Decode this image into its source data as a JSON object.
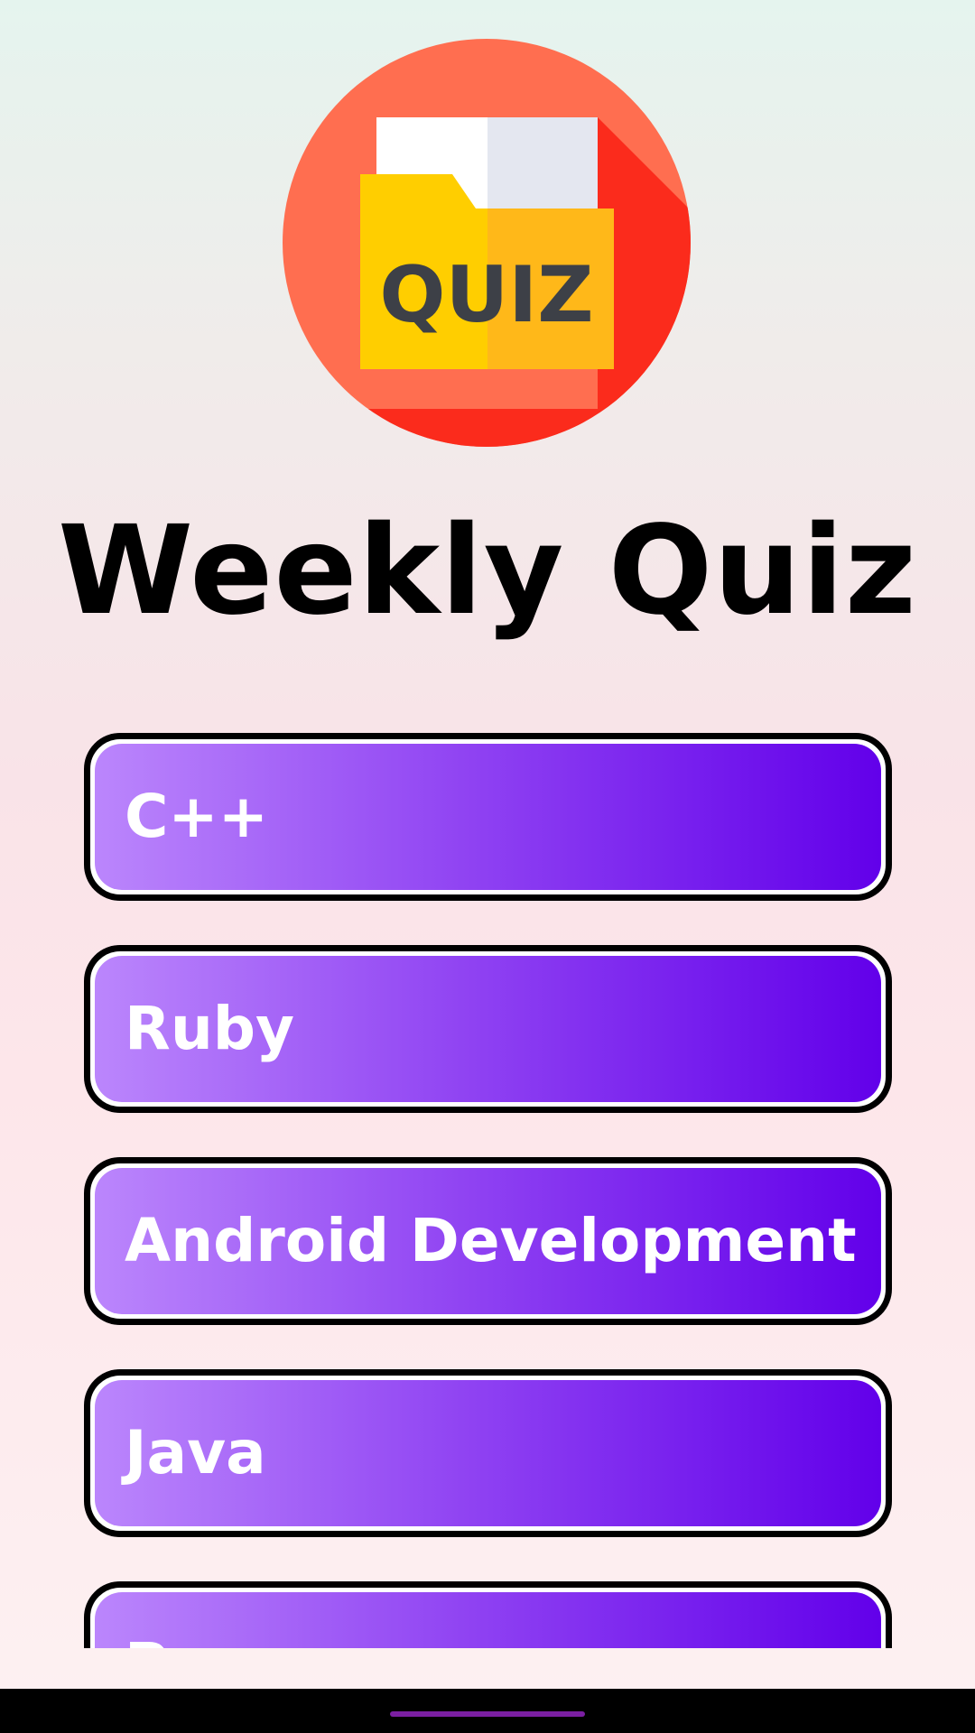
{
  "app": {
    "title": "Weekly Quiz"
  },
  "logo": {
    "icon": "quiz-folder-icon",
    "text": "QUIZ",
    "colors": {
      "circle": "#ff6e50",
      "circle_shadow": "#fb2b1c",
      "folder_front": "#ffce00",
      "folder_front_shade": "#ffb819",
      "paper": "#ffffff",
      "paper_shade": "#e4e7f0",
      "text": "#3d4047"
    }
  },
  "topics": [
    {
      "label": "C++"
    },
    {
      "label": "Ruby"
    },
    {
      "label": "Android Development"
    },
    {
      "label": "Java"
    },
    {
      "label": "P"
    }
  ],
  "colors": {
    "button_gradient_start": "#bb86fc",
    "button_gradient_end": "#6200ea",
    "button_border": "#000000",
    "home_handle": "#7b1fa2"
  }
}
